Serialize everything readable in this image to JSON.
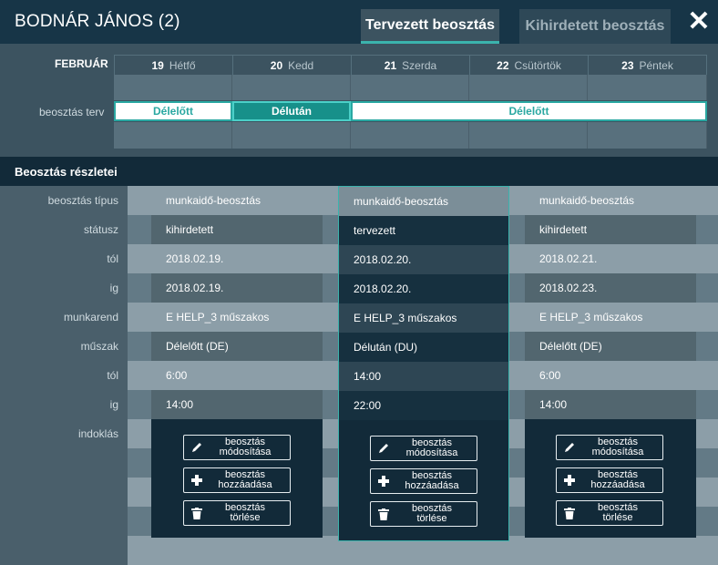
{
  "header": {
    "title": "BODNÁR JÁNOS (2)",
    "tab_planned": "Tervezett beosztás",
    "tab_announced": "Kihirdetett beosztás",
    "close": "✕"
  },
  "calendar": {
    "month": "FEBRUÁR",
    "row_label": "beosztás terv",
    "days": [
      {
        "num": "19",
        "name": "Hétfő"
      },
      {
        "num": "20",
        "name": "Kedd"
      },
      {
        "num": "21",
        "name": "Szerda"
      },
      {
        "num": "22",
        "name": "Csütörtök"
      },
      {
        "num": "23",
        "name": "Péntek"
      }
    ],
    "bars": [
      {
        "label": "Délelőtt",
        "style": "white"
      },
      {
        "label": "Délután",
        "style": "teal"
      },
      {
        "label": "Délelőtt",
        "style": "white"
      }
    ]
  },
  "section_title": "Beosztás részletei",
  "detail_labels": [
    "beosztás típus",
    "státusz",
    "tól",
    "ig",
    "munkarend",
    "műszak",
    "tól",
    "ig",
    "indoklás"
  ],
  "columns": [
    {
      "values": [
        "munkaidő-beosztás",
        "kihirdetett",
        "2018.02.19.",
        "2018.02.19.",
        "E HELP_3 műszakos",
        "Délelőtt (DE)",
        "6:00",
        "14:00"
      ]
    },
    {
      "values": [
        "munkaidő-beosztás",
        "tervezett",
        "2018.02.20.",
        "2018.02.20.",
        "E HELP_3 műszakos",
        "Délután (DU)",
        "14:00",
        "22:00"
      ]
    },
    {
      "values": [
        "munkaidő-beosztás",
        "kihirdetett",
        "2018.02.21.",
        "2018.02.23.",
        "E HELP_3 műszakos",
        "Délelőtt (DE)",
        "6:00",
        "14:00"
      ]
    }
  ],
  "buttons": {
    "edit": {
      "line1": "beosztás",
      "line2": "módosítása",
      "icon": "pencil-icon"
    },
    "add": {
      "line1": "beosztás",
      "line2": "hozzáadása",
      "icon": "plus-icon"
    },
    "delete": {
      "line1": "beosztás",
      "line2": "törlése",
      "icon": "trash-icon"
    }
  },
  "colors": {
    "accent": "#2aa8a2",
    "header": "#173547",
    "panel": "#122a39"
  }
}
